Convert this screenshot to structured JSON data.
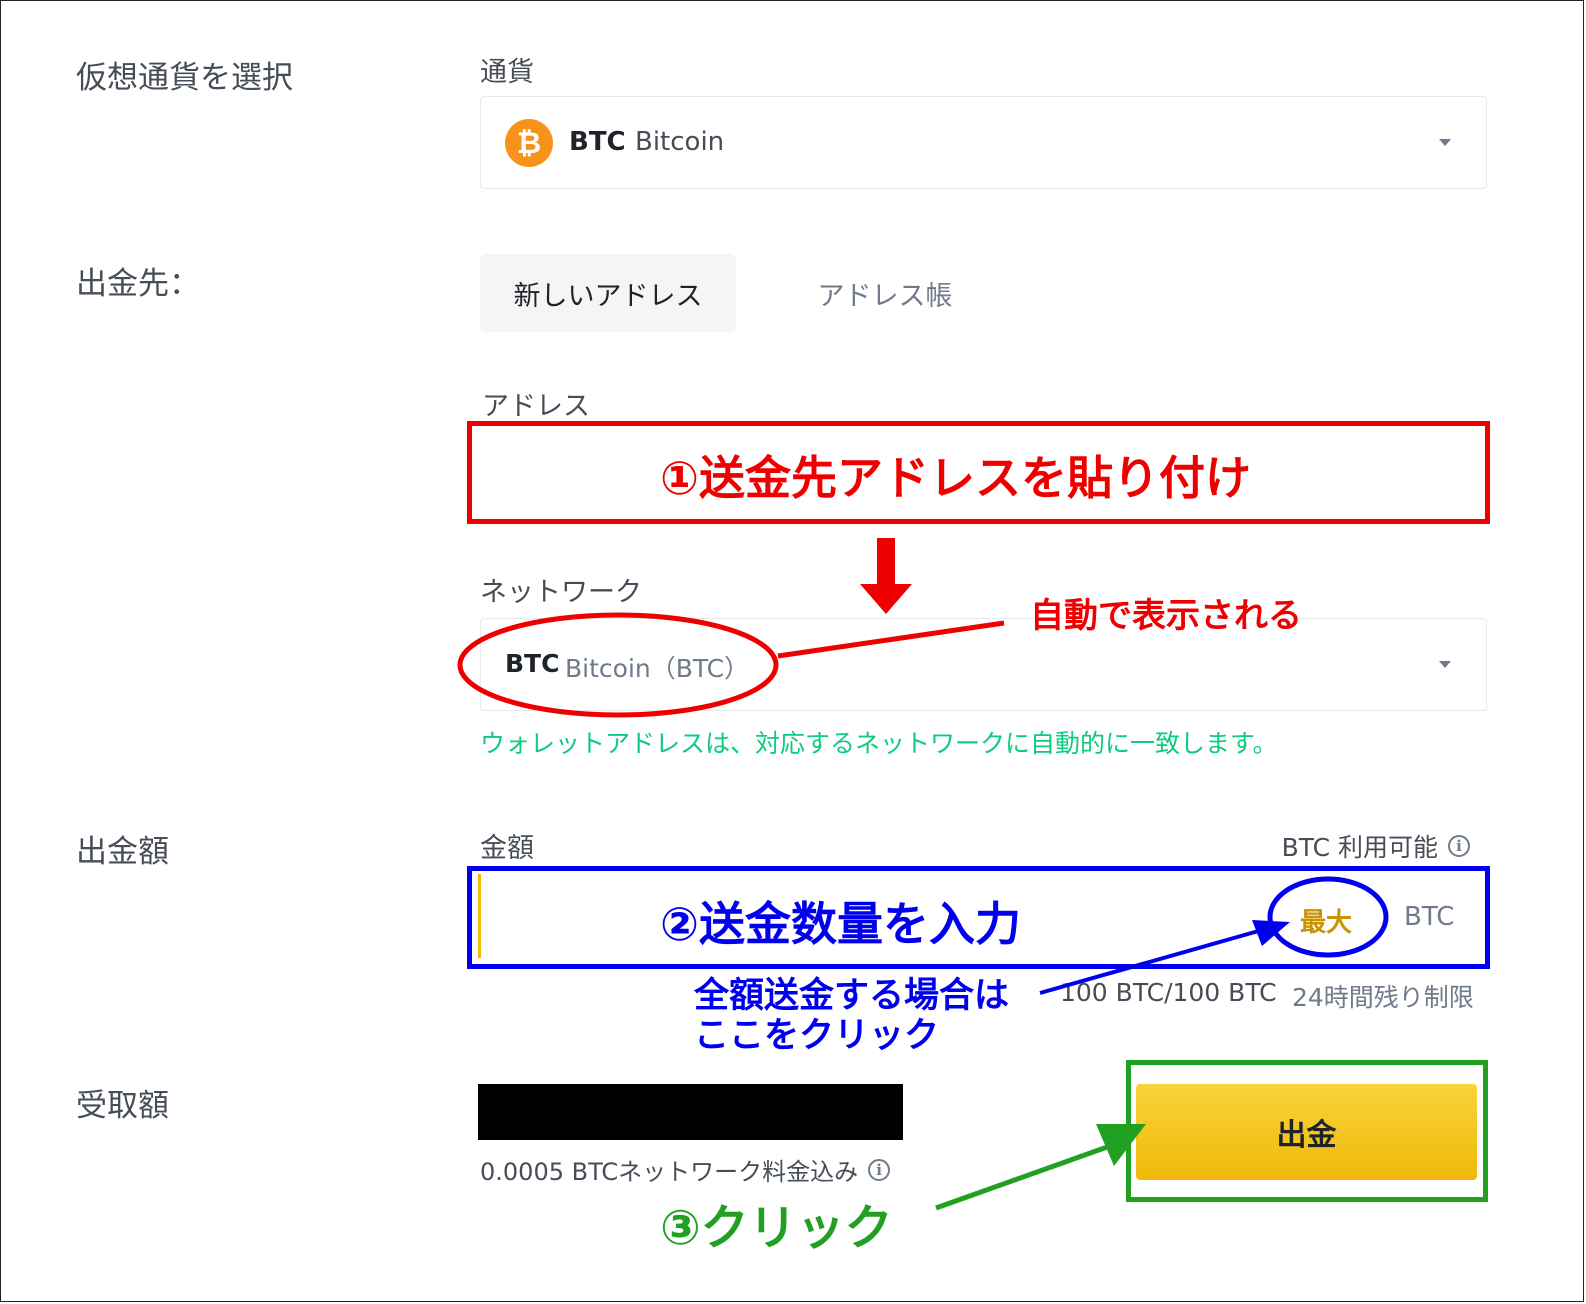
{
  "sections": {
    "select_crypto": "仮想通貨を選択",
    "destination": "出金先：",
    "withdraw_amount": "出金額",
    "receive_amount": "受取額"
  },
  "currency": {
    "label": "通貨",
    "symbol": "BTC",
    "name": "Bitcoin",
    "icon": "bitcoin-icon"
  },
  "tabs": {
    "new_address": "新しいアドレス",
    "address_book": "アドレス帳"
  },
  "address": {
    "label": "アドレス",
    "value": ""
  },
  "network": {
    "label": "ネットワーク",
    "symbol": "BTC",
    "name": "Bitcoin（BTC）",
    "hint": "ウォレットアドレスは、対応するネットワークに自動的に一致します。"
  },
  "amount": {
    "label": "金額",
    "available_label": "BTC 利用可能",
    "value": "",
    "max_label": "最大",
    "unit": "BTC",
    "limit_amount": "100 BTC/100 BTC",
    "limit_text": "24時間残り制限"
  },
  "receive": {
    "fee_note": "0.0005 BTCネットワーク料金込み"
  },
  "withdraw_button": "出金",
  "annotations": {
    "step1": "①送金先アドレスを貼り付け",
    "auto": "自動で表示される",
    "step2": "②送金数量を入力",
    "full_amount_line1": "全額送金する場合は",
    "full_amount_line2": "ここをクリック",
    "step3": "③クリック"
  },
  "colors": {
    "red": "#ee0000",
    "blue": "#0000ee",
    "green": "#22a022",
    "binance_yellow": "#f0b90b",
    "hint_green": "#0ecb81",
    "max_gold": "#c99400"
  }
}
